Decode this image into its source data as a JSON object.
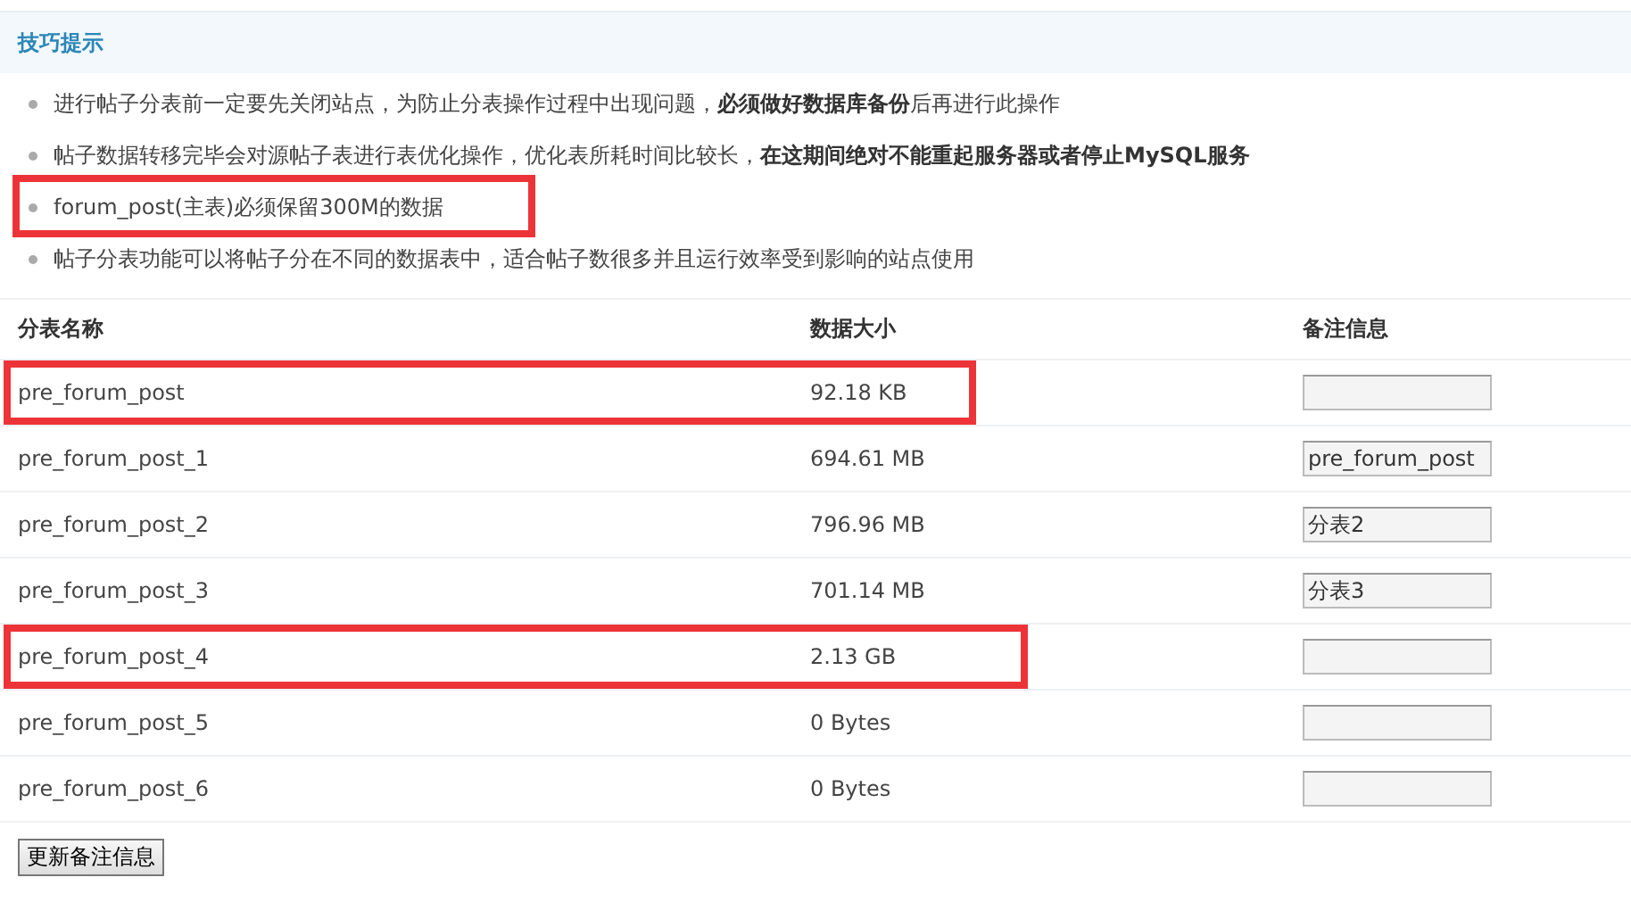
{
  "tips_panel": {
    "title": "技巧提示",
    "tips": [
      {
        "text": "进行帖子分表前一定要先关闭站点，为防止分表操作过程中出现问题，**必须做好数据库备份**后再进行此操作",
        "highlighted": false
      },
      {
        "text": "帖子数据转移完毕会对源帖子表进行表优化操作，优化表所耗时间比较长，**在这期间绝对不能重起服务器或者停止MySQL服务**",
        "highlighted": false
      },
      {
        "text": "forum_post(主表)必须保留300M的数据",
        "highlighted": true
      },
      {
        "text": "帖子分表功能可以将帖子分在不同的数据表中，适合帖子数很多并且运行效率受到影响的站点使用",
        "highlighted": false
      }
    ]
  },
  "table": {
    "columns": [
      "分表名称",
      "数据大小",
      "备注信息"
    ],
    "rows": [
      {
        "name": "pre_forum_post",
        "size": "92.18 KB",
        "highlighted": true
      },
      {
        "name": "pre_forum_post_1",
        "size": "694.61 MB",
        "note": "pre_forum_post",
        "highlighted": false
      },
      {
        "name": "pre_forum_post_2",
        "size": "796.96 MB",
        "note": "分表2",
        "highlighted": false
      },
      {
        "name": "pre_forum_post_3",
        "size": "701.14 MB",
        "note": "分表3",
        "highlighted": false
      },
      {
        "name": "pre_forum_post_4",
        "size": "2.13 GB",
        "highlighted": true
      },
      {
        "name": "pre_forum_post_5",
        "size": "0 Bytes",
        "highlighted": false
      },
      {
        "name": "pre_forum_post_6",
        "size": "0 Bytes",
        "highlighted": false
      }
    ]
  },
  "buttons": [
    "更新备注信息"
  ]
}
